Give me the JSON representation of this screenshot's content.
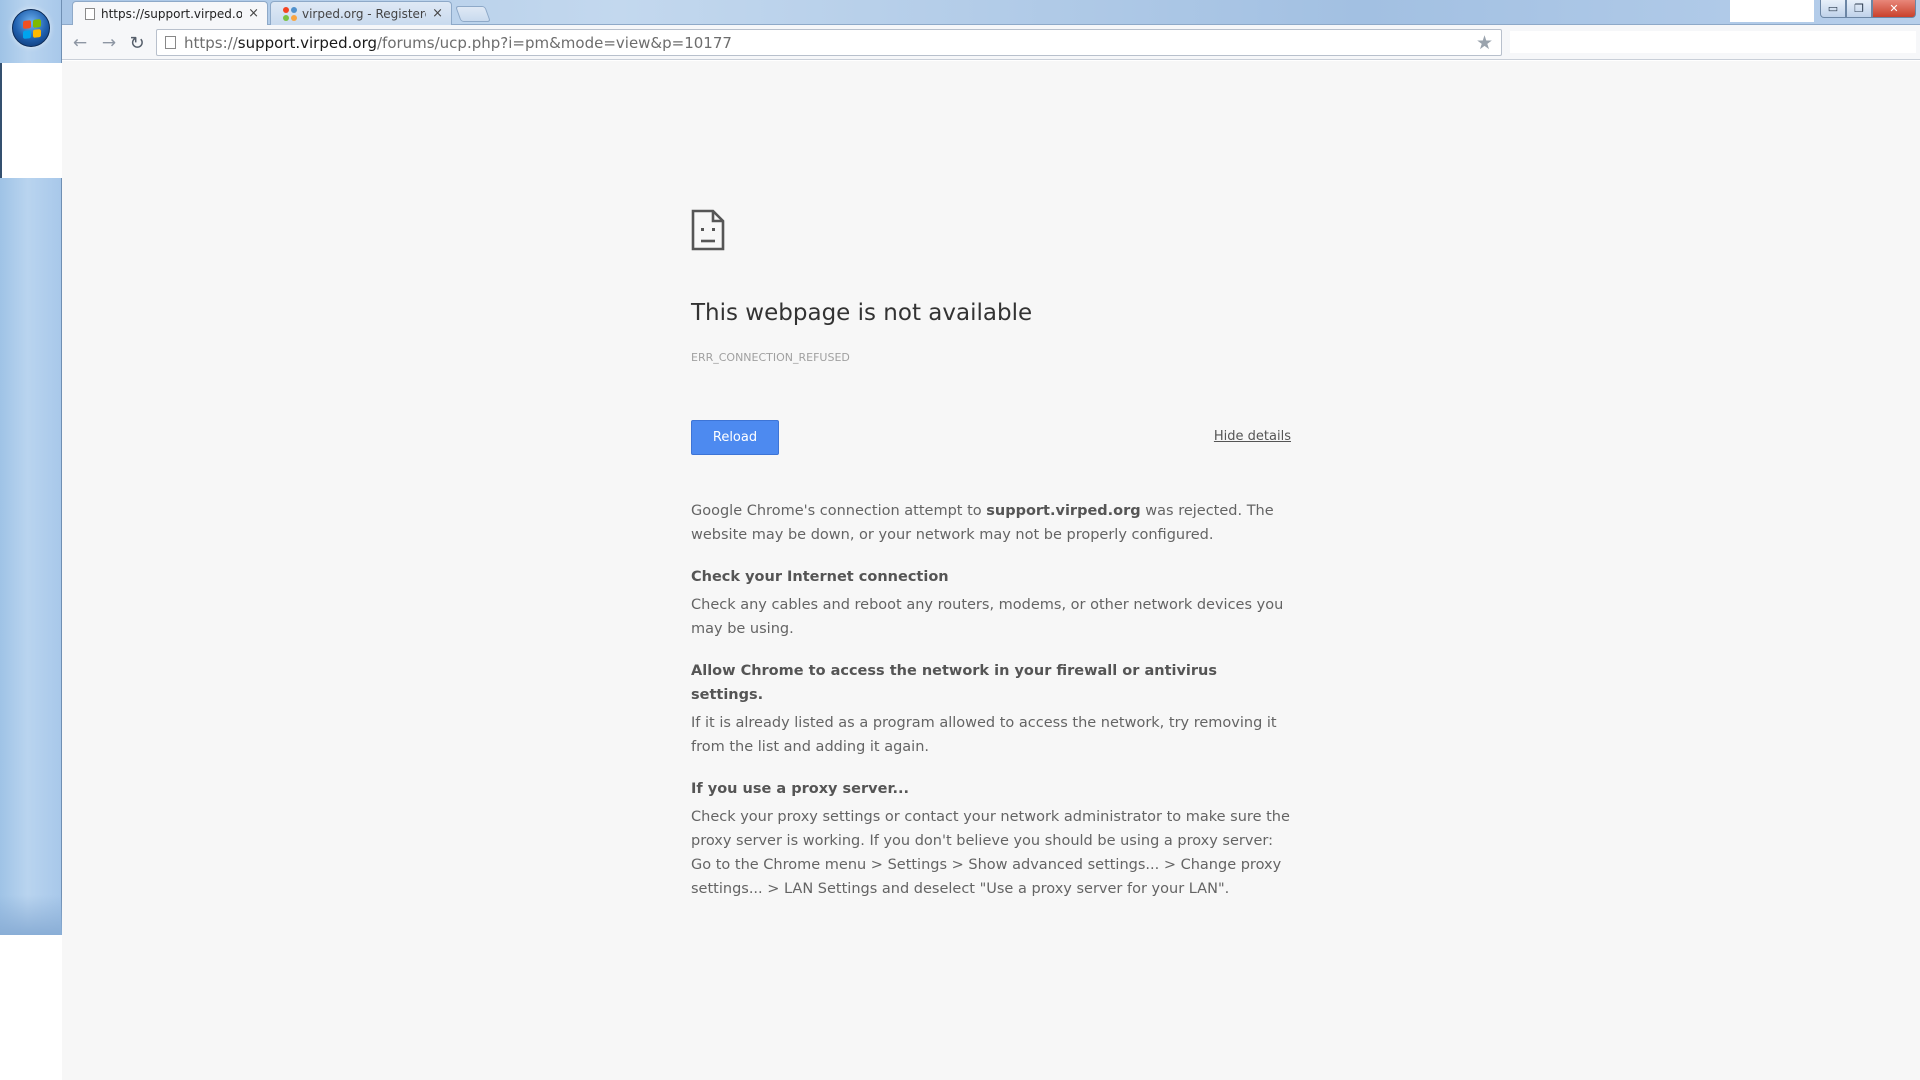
{
  "browser": {
    "tabs": [
      {
        "title": "https://support.virped.org",
        "close": "×"
      },
      {
        "title": "virped.org - Registered at",
        "close": "×"
      }
    ],
    "window_controls": {
      "minimize": "▭",
      "restore": "❐",
      "close": "✕"
    },
    "nav": {
      "back": "←",
      "forward": "→",
      "reload": "↻",
      "star": "★"
    },
    "address": {
      "scheme": "https://",
      "host": "support.virped.org",
      "path": "/forums/ucp.php?i=pm&mode=view&p=10177"
    }
  },
  "error_page": {
    "title": "This webpage is not available",
    "code": "ERR_CONNECTION_REFUSED",
    "reload_label": "Reload",
    "hide_details_label": "Hide details",
    "intro_prefix": "Google Chrome's connection attempt to ",
    "intro_host": "support.virped.org",
    "intro_suffix": " was rejected. The website may be down, or your network may not be properly configured.",
    "sections": [
      {
        "heading": "Check your Internet connection",
        "body": "Check any cables and reboot any routers, modems, or other network devices you may be using."
      },
      {
        "heading": "Allow Chrome to access the network in your firewall or antivirus settings.",
        "body": "If it is already listed as a program allowed to access the network, try removing it from the list and adding it again."
      },
      {
        "heading": "If you use a proxy server...",
        "body": "Check your proxy settings or contact your network administrator to make sure the proxy server is working. If you don't believe you should be using a proxy server: Go to the Chrome menu > Settings > Show advanced settings... > Change proxy settings... > LAN Settings and deselect \"Use a proxy server for your LAN\"."
      }
    ]
  },
  "colors": {
    "reload_button": "#4d8af0",
    "page_background": "#f7f7f7",
    "taskbar": "#b9d4ef"
  }
}
